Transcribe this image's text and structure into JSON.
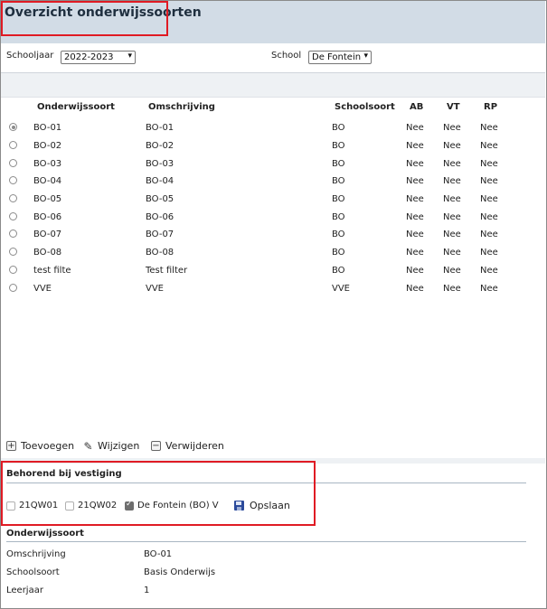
{
  "header": {
    "title": "Overzicht onderwijssoorten"
  },
  "filters": {
    "schooljaar_label": "Schooljaar",
    "schooljaar_value": "2022-2023",
    "school_label": "School",
    "school_value": "De Fontein"
  },
  "table": {
    "columns": [
      "Onderwijssoort",
      "Omschrijving",
      "Schoolsoort",
      "AB",
      "VT",
      "RP"
    ],
    "rows": [
      {
        "code": "BO-01",
        "omschrijving": "BO-01",
        "schoolsoort": "BO",
        "ab": "Nee",
        "vt": "Nee",
        "rp": "Nee",
        "selected": true
      },
      {
        "code": "BO-02",
        "omschrijving": "BO-02",
        "schoolsoort": "BO",
        "ab": "Nee",
        "vt": "Nee",
        "rp": "Nee",
        "selected": false
      },
      {
        "code": "BO-03",
        "omschrijving": "BO-03",
        "schoolsoort": "BO",
        "ab": "Nee",
        "vt": "Nee",
        "rp": "Nee",
        "selected": false
      },
      {
        "code": "BO-04",
        "omschrijving": "BO-04",
        "schoolsoort": "BO",
        "ab": "Nee",
        "vt": "Nee",
        "rp": "Nee",
        "selected": false
      },
      {
        "code": "BO-05",
        "omschrijving": "BO-05",
        "schoolsoort": "BO",
        "ab": "Nee",
        "vt": "Nee",
        "rp": "Nee",
        "selected": false
      },
      {
        "code": "BO-06",
        "omschrijving": "BO-06",
        "schoolsoort": "BO",
        "ab": "Nee",
        "vt": "Nee",
        "rp": "Nee",
        "selected": false
      },
      {
        "code": "BO-07",
        "omschrijving": "BO-07",
        "schoolsoort": "BO",
        "ab": "Nee",
        "vt": "Nee",
        "rp": "Nee",
        "selected": false
      },
      {
        "code": "BO-08",
        "omschrijving": "BO-08",
        "schoolsoort": "BO",
        "ab": "Nee",
        "vt": "Nee",
        "rp": "Nee",
        "selected": false
      },
      {
        "code": "test filte",
        "omschrijving": "Test filter",
        "schoolsoort": "BO",
        "ab": "Nee",
        "vt": "Nee",
        "rp": "Nee",
        "selected": false
      },
      {
        "code": "VVE",
        "omschrijving": "VVE",
        "schoolsoort": "VVE",
        "ab": "Nee",
        "vt": "Nee",
        "rp": "Nee",
        "selected": false
      }
    ]
  },
  "toolbar": {
    "add_label": "Toevoegen",
    "edit_label": "Wijzigen",
    "delete_label": "Verwijderen"
  },
  "vestiging": {
    "title": "Behorend bij vestiging",
    "items": [
      {
        "label": "21QW01",
        "checked": false
      },
      {
        "label": "21QW02",
        "checked": false
      },
      {
        "label": "De Fontein (BO) V",
        "checked": true
      }
    ],
    "save_label": "Opslaan"
  },
  "details": {
    "title": "Onderwijssoort",
    "omschrijving_label": "Omschrijving",
    "omschrijving_value": "BO-01",
    "schoolsoort_label": "Schoolsoort",
    "schoolsoort_value": "Basis Onderwijs",
    "leerjaar_label": "Leerjaar",
    "leerjaar_value": "1"
  },
  "colors": {
    "header_bg": "#d2dce6",
    "highlight_border": "#e01b24"
  }
}
